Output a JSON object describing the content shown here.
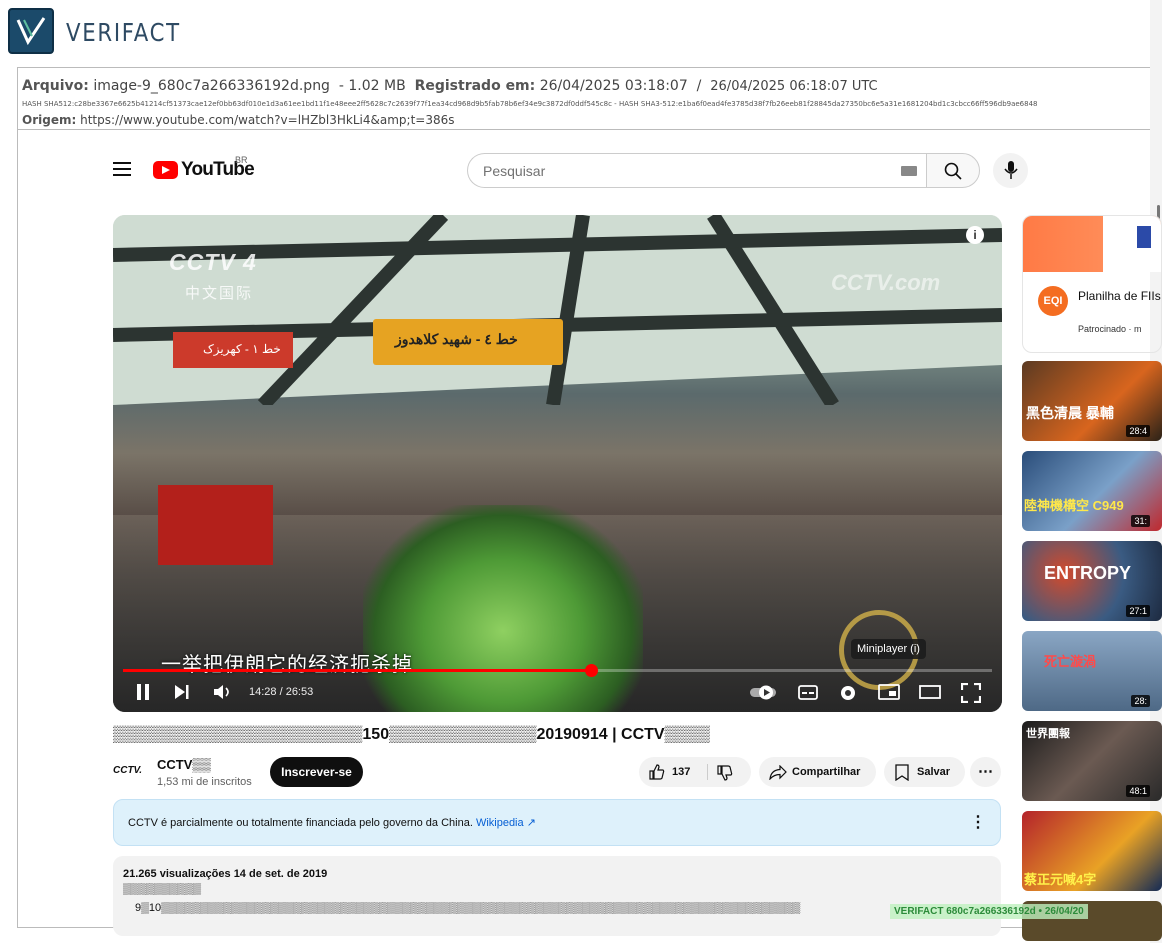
{
  "verifact": {
    "brand": "VERIFACT",
    "arquivo_label": "Arquivo:",
    "arquivo_value": "image-9_680c7a266336192d.png",
    "size": "- 1.02 MB",
    "registrado_label": "Registrado em:",
    "registrado_value": "26/04/2025 03:18:07",
    "separator": "/",
    "utc_value": "26/04/2025 06:18:07 UTC",
    "hash_line": "HASH SHA512:c28be3367e6625b41214cf51373cae12ef0bb63df010e1d3a61ee1bd11f1e48eee2ff5628c7c2639f77f1ea34cd968d9b5fab78b6ef34e9c3872df0ddf545c8c    -    HASH SHA3-512:e1ba6f0ead4fe3785d38f7fb26eeb81f28845da27350bc6e5a31e1681204bd1c3cbcc66ff596db9ae6848",
    "origem_label": "Origem:",
    "origem_value": "https://www.youtube.com/watch?v=lHZbl3HkLi4&amp;t=386s",
    "stamp": "VERIFACT 680c7a266336192d • 26/04/20"
  },
  "youtube": {
    "logo_text": "YouTube",
    "country_code": "BR",
    "search_placeholder": "Pesquisar"
  },
  "video": {
    "watermark_left": "CCTV 4",
    "watermark_left_sub": "中文国际",
    "watermark_right": "CCTV.com",
    "subtitle": "一举把伊朗它的经济扼杀掉",
    "tooltip": "Miniplayer (i)",
    "time": "14:28 / 26:53",
    "progress": 0.538,
    "sign_left": "خط ۱ - کهریزک",
    "sign_center": "خط ٤ - شهید کلاهدوز"
  },
  "details": {
    "title": "▒▒▒▒▒▒▒▒▒▒▒▒▒▒▒▒▒▒▒▒▒▒150▒▒▒▒▒▒▒▒▒▒▒▒▒20190914 | CCTV▒▒▒▒",
    "channel_logo": "CCTV.",
    "channel_name": "CCTV▒▒",
    "subscribers": "1,53 mi de inscritos",
    "subscribe_label": "Inscrever-se",
    "likes": "137",
    "share_label": "Compartilhar",
    "save_label": "Salvar",
    "notice_text": "CCTV é parcialmente ou totalmente financiada pelo governo da China.",
    "notice_link": "Wikipedia",
    "views_date": "21.265 visualizações  14 de set. de 2019",
    "desc_line2": "▒▒▒▒▒▒▒▒▒▒",
    "desc_line3": "9▒10▒▒▒▒▒▒▒▒▒▒▒▒▒▒▒▒▒▒▒▒▒▒▒▒▒▒▒▒▒▒▒▒▒▒▒▒▒▒▒▒▒▒▒▒▒▒▒▒▒▒▒▒▒▒▒▒▒▒▒▒▒▒▒▒▒▒▒▒▒▒▒▒▒▒▒▒▒▒▒▒▒▒"
  },
  "sidebar": {
    "ad_title": "Planilha de FIIs",
    "ad_logo": "EQI",
    "ad_sponsor": "Patrocinado · m",
    "thumbs": [
      {
        "label": "黑色清晨 暴輔",
        "duration": "28:4",
        "color": "#3a2a1e"
      },
      {
        "label": "陸神機構空 C949",
        "duration": "31:",
        "color": "#20304a"
      },
      {
        "label": "ENTROPY",
        "duration": "27:1",
        "color": "#283c5a"
      },
      {
        "label": "死亡漩渦",
        "duration": "28:",
        "color": "#5a6e86"
      },
      {
        "label": "世界團報",
        "duration": "48:1",
        "color": "#2b2b2b"
      },
      {
        "label": "蔡正元喊4字",
        "duration": "",
        "color": "#a8232c"
      }
    ]
  },
  "colors": {
    "accent": "#ff0000",
    "brand": "#1b4a6a"
  }
}
